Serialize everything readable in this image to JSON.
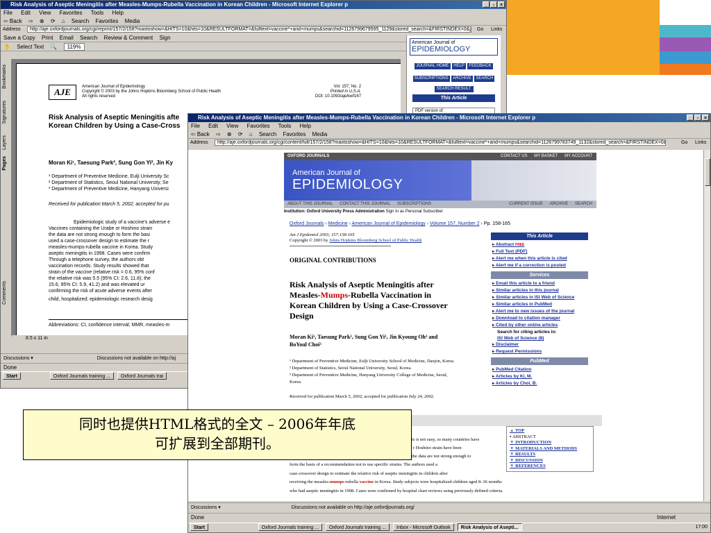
{
  "colors": {
    "strip1": "#f5a623",
    "strip2": "#4db8c9",
    "strip3": "#9b59b6",
    "strip4": "#3d9ad1",
    "strip5": "#f07a1e",
    "accent": "#1e3c8c",
    "red": "#cc0000",
    "title_bar": "#0a246a"
  },
  "back_window": {
    "title": "Risk Analysis of Aseptic Meningitis after Measles-Mumps-Rubella Vaccination in Korean Children - Microsoft Internet Explorer p",
    "menu": [
      "File",
      "Edit",
      "View",
      "Favorites",
      "Tools",
      "Help"
    ],
    "toolbar": [
      "⇦ Back",
      "⇨",
      "⊗",
      "⟳",
      "⌂",
      "Search",
      "Favorites",
      "Media"
    ],
    "address_label": "Address",
    "url": "http://aje.oxfordjournals.org/cgi/reprint/157/2/158?maxtoshow=&HITS=10&hits=10&RESULTFORMAT=&fulltext=vaccine*+and+mumps&searchid=1126799679595_1129&stored_search=&FIRSTINDEX=0&journalcode=amjepi",
    "go": "Go",
    "links": "Links",
    "pdf_tools": [
      "Save a Copy",
      "Print",
      "Email",
      "Search",
      "Review & Comment",
      "Sign"
    ],
    "pdf_tools2": [
      "Select Text",
      "119%"
    ],
    "side_tabs": [
      "Bookmarks",
      "Signatures",
      "Layers",
      "Pages",
      "Comments"
    ],
    "journal": "American Journal of Epidemiology",
    "copyright": "Copyright © 2003 by the Johns Hopkins Bloomberg School of Public Health",
    "rights": "All rights reserved",
    "vol": "Vol. 157, No. 2",
    "printed": "Printed in U.S.A.",
    "doi": "DOI: 10.1093/aje/kwf167",
    "paper_title_1": "Risk Analysis of Aseptic Meningitis afte",
    "paper_title_2": "Korean Children by Using a Case-Cross",
    "authors": "Moran Ki¹, Taesung Park², Sung Gon Yi², Jin Ky",
    "dept": [
      "¹ Department of Preventive Medicine, Eulji University Sc",
      "² Department of Statistics, Seoul National University, Se",
      "³ Department of Preventive Medicine, Hanyang Universi"
    ],
    "received": "Received for publication March 5, 2002; accepted for pu",
    "abstract": [
      "Epidemiologic study of a vaccine's adverse e",
      "Vaccines containing the Urabe or Hoshino strain",
      "the data are not strong enough to form the basi",
      "used a case-crossover design to estimate the r",
      "measles-mumps-rubella vaccine in Korea. Study",
      "aseptic meningitis in 1998. Cases were confirm",
      "Through a telephone survey, the authors obt",
      "vaccination records. Study results showed that",
      "strain of the vaccine (relative risk = 0.6, 95% conf",
      "the relative risk was 5.5 (95% CI: 2.6, 11.8); the",
      "15.6, 95% CI: 5.9, 41.2) and was elevated ur",
      "confirming the risk of acute adverse events after"
    ],
    "keywords": "child, hospitalized; epidemiologic research desig",
    "abbrev": "Abbreviations: CI, confidence interval; MMR, measles-m",
    "page_size": "8.5 x 11 in",
    "side_journal_1": "American Journal of",
    "side_journal_2": "EPIDEMIOLOGY",
    "side_nav": [
      "JOURNAL HOME",
      "HELP",
      "FEEDBACK",
      "SUBSCRIPTIONS",
      "ARCHIVE",
      "SEARCH",
      "SEARCH RESULT"
    ],
    "this_article": "This Article",
    "pdf_version": "PDF version of:",
    "bottom_bar": "Discussions ▾",
    "discussions_msg": "Discussions not available on http://aj",
    "status": "Done",
    "taskbar": [
      "Start",
      "Oxford Journals training ...",
      "Oxford Journals trai"
    ]
  },
  "front_window": {
    "title": "Risk Analysis of Aseptic Meningitis after Measles-Mumps-Rubella Vaccination in Korean Children - Microsoft Internet Explorer p",
    "menu": [
      "File",
      "Edit",
      "View",
      "Favorites",
      "Tools",
      "Help"
    ],
    "toolbar": [
      "⇦ Back",
      "⇨",
      "⊗",
      "⟳",
      "⌂",
      "Search",
      "Favorites",
      "Media"
    ],
    "address_label": "Address",
    "url": "http://aje.oxfordjournals.org/cgi/content/full/157/2/158?maxtoshow=&HITS=10&hits=10&RESULTFORMAT=&fulltext=vaccine*+and+mumps&searchid=1126799783749_1132&stored_search=&FIRSTINDEX=0&journalcode=am",
    "go": "Go",
    "links": "Links",
    "oxford": "OXFORD JOURNALS",
    "top_links": [
      "CONTACT US",
      "MY BASKET",
      "MY ACCOUNT"
    ],
    "banner_1": "American Journal of",
    "banner_2": "EPIDEMIOLOGY",
    "nav": [
      "ABOUT THIS JOURNAL",
      "CONTACT THIS JOURNAL",
      "SUBSCRIPTIONS"
    ],
    "nav_right": [
      "CURRENT ISSUE",
      "ARCHIVE",
      "SEARCH"
    ],
    "institution": "Institution: Oxford University Press Administration",
    "sign_in": "Sign In as Personal Subscriber",
    "breadcrumb": [
      "Oxford Journals",
      "Medicine",
      "American Journal of Epidemiology",
      "Volume 157, Number 2"
    ],
    "pages": "Pp. 158-165",
    "citation": "Am J Epidemiol 2003; 157:158-165",
    "copyright": "Copyright © 2003 by",
    "copyright_link": "Johns Hopkins Bloomberg School of Public Health",
    "section": "ORIGINAL CONTRIBUTIONS",
    "title_a": "Risk Analysis of Aseptic Meningitis after",
    "title_b1": "Measles-",
    "title_mumps": "Mumps",
    "title_b2": "-Rubella Vaccination in",
    "title_c": "Korean Children by Using a Case-Crossover",
    "title_d": "Design",
    "authors_1": "Moran Ki¹, Taesung Park², Sung Gon Yi², Jin Kyoung Oh³ and",
    "authors_2": "BoYoul Choi³",
    "depts": [
      "¹ Department of Preventive Medicine, Eulji University School of Medicine, Daejon, Korea.",
      "² Department of Statistics, Seoul National University, Seoul, Korea.",
      "³ Department of Preventive Medicine, Hanyang University College of Medicine, Seoul,",
      "Korea."
    ],
    "received": "Received for publication March 5, 2002; accepted for publication July 24, 2002.",
    "this_article": "This Article",
    "article_links": [
      "Abstract",
      "Full Text (PDF)",
      "Alert me when this article is cited",
      "Alert me if a correction is posted"
    ],
    "free": "FREE",
    "services": "Services",
    "service_links": [
      "Email this article to a friend",
      "Similar articles in this journal",
      "Similar articles in ISI Web of Science",
      "Similar articles in PubMed",
      "Alert me to new issues of the journal",
      "Download to citation manager",
      "Cited by other online articles"
    ],
    "search_citing": "Search for citing articles in:",
    "wos_link": "ISI Web of Science (8)",
    "more_links": [
      "Disclaimer",
      "Request Permissions"
    ],
    "pubmed": "PubMed",
    "pubmed_links": [
      "PubMed Citation",
      "Articles by Ki, M.",
      "Articles by Choi, B."
    ],
    "toc": [
      "TOP",
      "ABSTRACT",
      "INTRODUCTION",
      "MATERIALS AND METHODS",
      "RESULTS",
      "DISCUSSION",
      "REFERENCES"
    ],
    "body_frag": [
      "ts is not easy, so many countries have",
      "r Hoshino strain have been",
      "the data are not strong enough to"
    ],
    "body_1": "form the basis of a recommendation not to use specific strains. The authors used a",
    "body_2": "case-crossover design to estimate the relative risk of aseptic meningitis in children after",
    "body_3a": "receiving the measles-",
    "body_3b": "mumps",
    "body_3c": "-rubella",
    "body_3d": "vaccine",
    "body_3e": "in Korea. Study subjects were hospitalized children aged 8–36 months",
    "body_4": "who had aseptic meningitis in 1998. Cases were confirmed by hospital chart reviews using previously defined criteria.",
    "bottom_bar": "Discussions ▾",
    "discussions_msg": "Discussions not available on http://aje.oxfordjournals.org/",
    "status": "Done",
    "zone": "Internet",
    "taskbar": [
      "Start",
      "Oxford Journals training ...",
      "Oxford Journals training ...",
      "Inbox - Microsoft Outlook",
      "Risk Analysis of Asepti..."
    ],
    "clock": "17:00"
  },
  "caption": {
    "line1": "同时也提供HTML格式的全文 – 2006年年底",
    "line2": "可扩展到全部期刊。"
  }
}
